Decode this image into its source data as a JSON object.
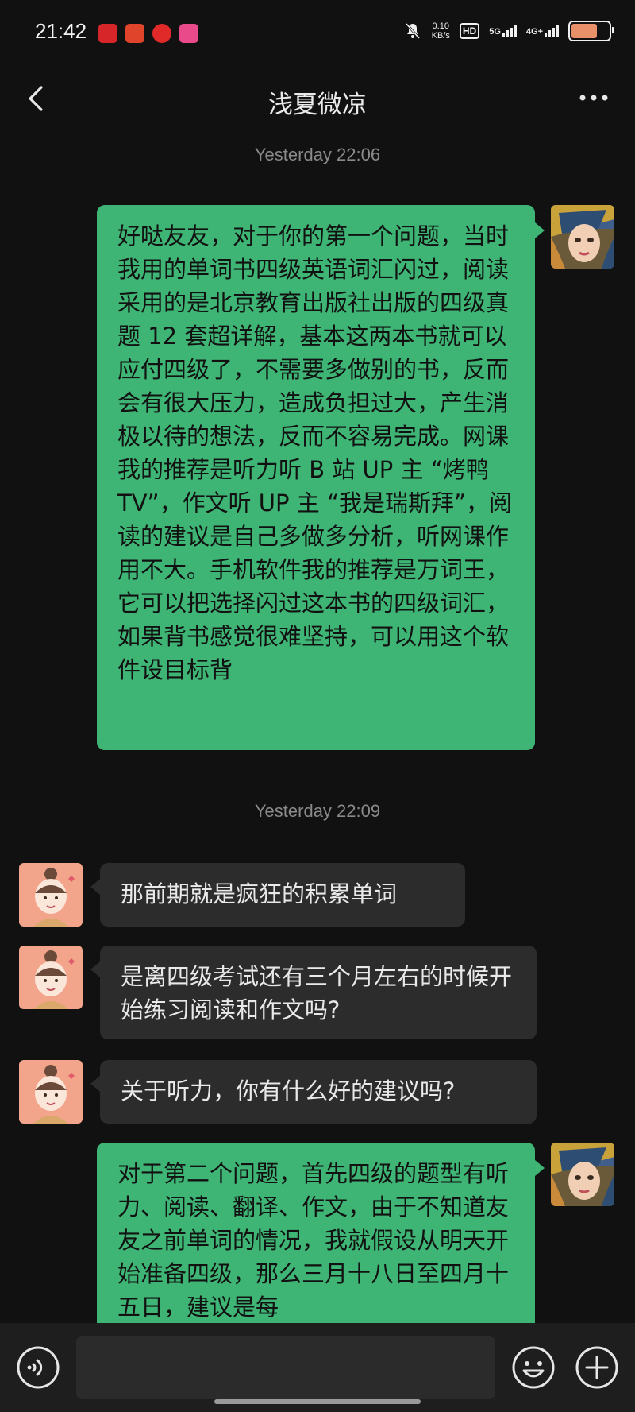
{
  "status_bar": {
    "time": "21:42",
    "net_speed_value": "0.10",
    "net_speed_unit": "KB/s",
    "hd": "HD",
    "signal_1": "5G",
    "signal_2": "4G+",
    "battery_level": 0.7
  },
  "header": {
    "back_icon": "chevron-left-icon",
    "title": "浅夏微凉",
    "more_icon": "more-dots-icon"
  },
  "messages": [
    {
      "type": "time",
      "text": "Yesterday 22:06"
    },
    {
      "type": "msg",
      "sender": "me",
      "text": "好哒友友，对于你的第一个问题，当时我用的单词书四级英语词汇闪过，阅读采用的是北京教育出版社出版的四级真题 12 套超详解，基本这两本书就可以应付四级了，不需要多做别的书，反而会有很大压力，造成负担过大，产生消极以待的想法，反而不容易完成。网课我的推荐是听力听 B 站 UP 主 “烤鸭 TV”，作文听 UP 主 “我是瑞斯拜”，阅读的建议是自己多做多分析，听网课作用不大。手机软件我的推荐是万词王，它可以把选择闪过这本书的四级词汇，如果背书感觉很难坚持，可以用这个软件设目标背"
    },
    {
      "type": "time",
      "text": "Yesterday 22:09"
    },
    {
      "type": "msg",
      "sender": "other",
      "text": "那前期就是疯狂的积累单词"
    },
    {
      "type": "msg",
      "sender": "other",
      "text": "是离四级考试还有三个月左右的时候开始练习阅读和作文吗?"
    },
    {
      "type": "msg",
      "sender": "other",
      "text": "关于听力，你有什么好的建议吗?"
    },
    {
      "type": "msg",
      "sender": "me",
      "text": "对于第二个问题，首先四级的题型有听力、阅读、翻译、作文，由于不知道友友之前单词的情况，我就假设从明天开始准备四级，那么三月十八日至四月十五日，建议是每"
    }
  ],
  "input_bar": {
    "voice_icon": "voice-icon",
    "emoji_icon": "emoji-icon",
    "add_icon": "plus-icon"
  },
  "colors": {
    "background": "#111111",
    "my_bubble": "#3eb575",
    "other_bubble": "#2c2c2c",
    "timestamp": "#8a8a8a"
  }
}
